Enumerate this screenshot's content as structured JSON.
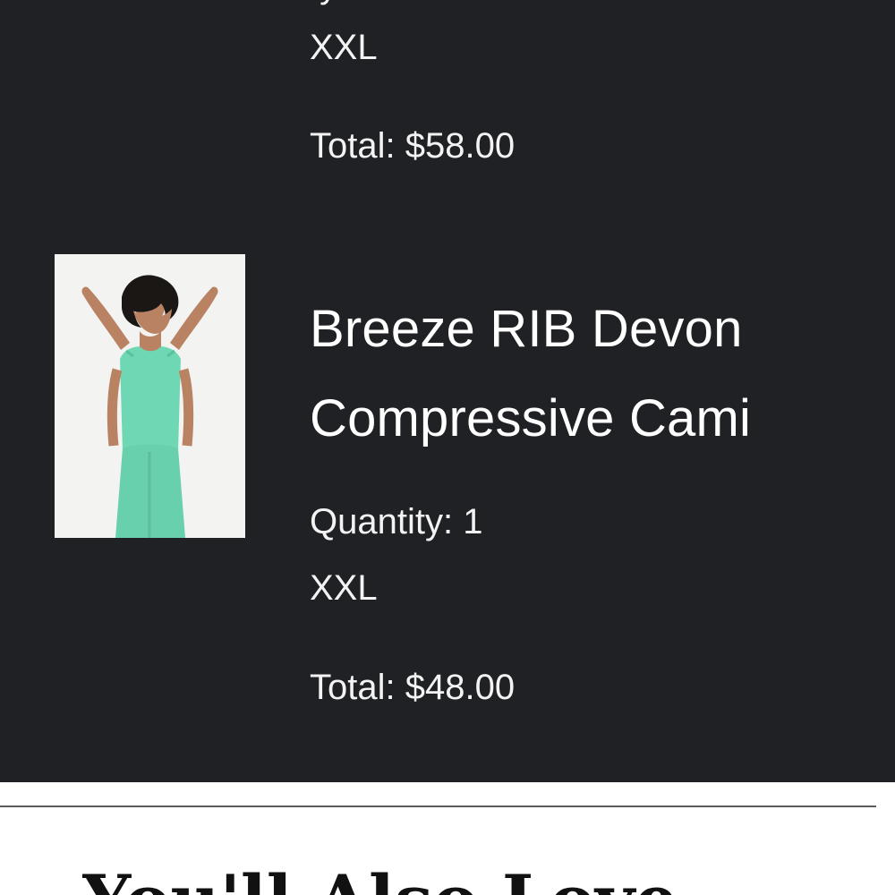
{
  "previous_item": {
    "partial_text": "ty",
    "size": "XXL",
    "total": "Total: $58.00"
  },
  "current_item": {
    "image_icon": "product-photo-icon",
    "title_line_1": "Breeze RIB Devon",
    "title_line_2": "Compressive Cami",
    "quantity": "Quantity: 1",
    "size": "XXL",
    "total": "Total: $48.00"
  },
  "below_section": {
    "heading_partial": "You'll Also Love"
  },
  "colors": {
    "panel_background": "#202124",
    "panel_text": "#f5f5f5",
    "product_image_background": "#f3f3f1",
    "garment_color": "#6ed8b4",
    "divider": "#5c5c5c",
    "lower_heading": "#111111"
  }
}
